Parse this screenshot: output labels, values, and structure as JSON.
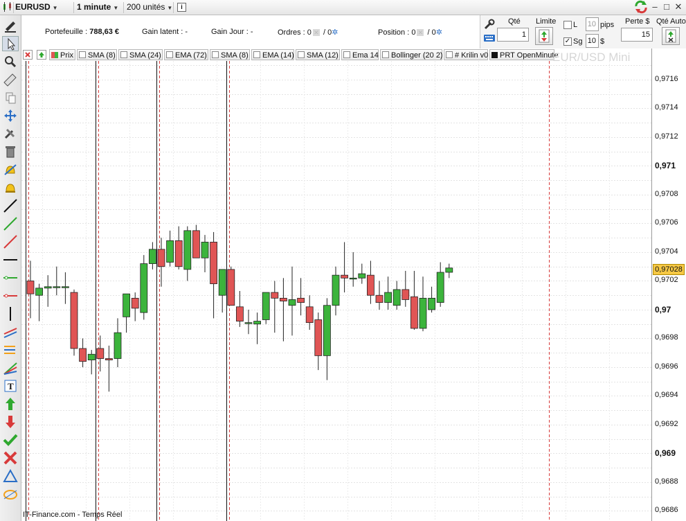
{
  "topbar": {
    "symbol": "EURUSD",
    "timeframe": "1 minute",
    "units": "200 unités",
    "info_icon": "i"
  },
  "account": {
    "portfolio_label": "Portefeuille :",
    "portfolio_value": "788,63 €",
    "latent_label": "Gain latent :",
    "latent_value": "-",
    "day_label": "Gain Jour :",
    "day_value": "-",
    "orders_label": "Ordres :",
    "orders_value_a": "0",
    "orders_sep": "/",
    "orders_value_b": "0",
    "position_label": "Position :",
    "position_value_a": "0",
    "position_sep": "/",
    "position_value_b": "0"
  },
  "order_panel": {
    "qty_label": "Qté",
    "qty_value": "1",
    "limit_label": "Limite",
    "l_label": "L",
    "l_value": "10",
    "l_checked": false,
    "pips_label": "pips",
    "sg_label": "Sg",
    "sg_value": "10",
    "sg_checked": true,
    "sg_unit": "$",
    "loss_label": "Perte $",
    "loss_value": "15",
    "auto_label": "Qté Auto"
  },
  "indicators": [
    {
      "label": "Prix"
    },
    {
      "label": "SMA (8)"
    },
    {
      "label": "SMA (24)"
    },
    {
      "label": "EMA (72)"
    },
    {
      "label": "SMA (8)"
    },
    {
      "label": "EMA (14)"
    },
    {
      "label": "SMA (12)"
    },
    {
      "label": "Ema 14"
    },
    {
      "label": "Bollinger (20 2)"
    },
    {
      "label": "# Krilin v0"
    },
    {
      "label": "PRT OpenMinute"
    }
  ],
  "watermark": "EUR/USD Mini",
  "footer": "IT-Finance.com - Temps Réel",
  "chart_data": {
    "type": "candlestick",
    "symbol": "EUR/USD Mini",
    "ylim": [
      0.96853,
      0.97173
    ],
    "grid": true,
    "y_ticks": [
      "0,9716",
      "0,9714",
      "0,9712",
      "0,971",
      "0,9708",
      "0,9706",
      "0,9704",
      "0,9702",
      "0,97",
      "0,9698",
      "0,9696",
      "0,9694",
      "0,9692",
      "0,969",
      "0,9688",
      "0,9686"
    ],
    "last_price": "0,97028",
    "bullish_color": "#3cb43c",
    "bearish_color": "#e05555",
    "candles": [
      {
        "o": 0.9702,
        "h": 0.97034,
        "l": 0.96994,
        "c": 0.97011
      },
      {
        "o": 0.9701,
        "h": 0.97018,
        "l": 0.96992,
        "c": 0.97015
      },
      {
        "o": 0.97015,
        "h": 0.97024,
        "l": 0.97002,
        "c": 0.97016
      },
      {
        "o": 0.97016,
        "h": 0.9703,
        "l": 0.9701,
        "c": 0.97016
      },
      {
        "o": 0.97016,
        "h": 0.97026,
        "l": 0.97004,
        "c": 0.97016
      },
      {
        "o": 0.97012,
        "h": 0.97014,
        "l": 0.96968,
        "c": 0.96973
      },
      {
        "o": 0.96973,
        "h": 0.9698,
        "l": 0.9696,
        "c": 0.96964
      },
      {
        "o": 0.96965,
        "h": 0.96972,
        "l": 0.96955,
        "c": 0.96969
      },
      {
        "o": 0.96973,
        "h": 0.96982,
        "l": 0.96957,
        "c": 0.96966
      },
      {
        "o": 0.96966,
        "h": 0.96975,
        "l": 0.96943,
        "c": 0.96965
      },
      {
        "o": 0.96966,
        "h": 0.96994,
        "l": 0.9696,
        "c": 0.96984
      },
      {
        "o": 0.96995,
        "h": 0.9701,
        "l": 0.96984,
        "c": 0.97011
      },
      {
        "o": 0.97008,
        "h": 0.97012,
        "l": 0.96992,
        "c": 0.97001
      },
      {
        "o": 0.96998,
        "h": 0.97038,
        "l": 0.96993,
        "c": 0.97032
      },
      {
        "o": 0.97032,
        "h": 0.97047,
        "l": 0.97028,
        "c": 0.97042
      },
      {
        "o": 0.97042,
        "h": 0.9705,
        "l": 0.97016,
        "c": 0.9703
      },
      {
        "o": 0.97033,
        "h": 0.97055,
        "l": 0.9703,
        "c": 0.97048
      },
      {
        "o": 0.97048,
        "h": 0.97058,
        "l": 0.97028,
        "c": 0.9703
      },
      {
        "o": 0.97028,
        "h": 0.97058,
        "l": 0.9702,
        "c": 0.97055
      },
      {
        "o": 0.97055,
        "h": 0.97059,
        "l": 0.97036,
        "c": 0.97036
      },
      {
        "o": 0.97036,
        "h": 0.97052,
        "l": 0.97026,
        "c": 0.97047
      },
      {
        "o": 0.97047,
        "h": 0.97054,
        "l": 0.96994,
        "c": 0.97018
      },
      {
        "o": 0.9701,
        "h": 0.97025,
        "l": 0.96998,
        "c": 0.97028
      },
      {
        "o": 0.97028,
        "h": 0.9703,
        "l": 0.97003,
        "c": 0.97003
      },
      {
        "o": 0.97002,
        "h": 0.97013,
        "l": 0.96988,
        "c": 0.96992
      },
      {
        "o": 0.96991,
        "h": 0.97,
        "l": 0.96983,
        "c": 0.96991
      },
      {
        "o": 0.9699,
        "h": 0.96998,
        "l": 0.96976,
        "c": 0.96992
      },
      {
        "o": 0.96993,
        "h": 0.97012,
        "l": 0.9699,
        "c": 0.97012
      },
      {
        "o": 0.97012,
        "h": 0.9702,
        "l": 0.96984,
        "c": 0.97008
      },
      {
        "o": 0.97008,
        "h": 0.97022,
        "l": 0.96978,
        "c": 0.97006
      },
      {
        "o": 0.97003,
        "h": 0.9703,
        "l": 0.96982,
        "c": 0.97007
      },
      {
        "o": 0.97008,
        "h": 0.97022,
        "l": 0.96996,
        "c": 0.97005
      },
      {
        "o": 0.97002,
        "h": 0.9701,
        "l": 0.96986,
        "c": 0.96991
      },
      {
        "o": 0.96993,
        "h": 0.96998,
        "l": 0.96958,
        "c": 0.96968
      },
      {
        "o": 0.96968,
        "h": 0.97008,
        "l": 0.96951,
        "c": 0.97003
      },
      {
        "o": 0.97003,
        "h": 0.9703,
        "l": 0.96996,
        "c": 0.97024
      },
      {
        "o": 0.97024,
        "h": 0.97047,
        "l": 0.97012,
        "c": 0.97022
      },
      {
        "o": 0.97022,
        "h": 0.9704,
        "l": 0.97016,
        "c": 0.97022
      },
      {
        "o": 0.97022,
        "h": 0.97032,
        "l": 0.97018,
        "c": 0.97025
      },
      {
        "o": 0.97024,
        "h": 0.97034,
        "l": 0.97004,
        "c": 0.9701
      },
      {
        "o": 0.9701,
        "h": 0.9702,
        "l": 0.97,
        "c": 0.97005
      },
      {
        "o": 0.97005,
        "h": 0.97023,
        "l": 0.97,
        "c": 0.97012
      },
      {
        "o": 0.97003,
        "h": 0.9702,
        "l": 0.97,
        "c": 0.97014
      },
      {
        "o": 0.97014,
        "h": 0.97027,
        "l": 0.97002,
        "c": 0.97007
      },
      {
        "o": 0.97009,
        "h": 0.97027,
        "l": 0.96986,
        "c": 0.96987
      },
      {
        "o": 0.96987,
        "h": 0.97023,
        "l": 0.96985,
        "c": 0.97008
      },
      {
        "o": 0.97,
        "h": 0.97016,
        "l": 0.96998,
        "c": 0.97008
      },
      {
        "o": 0.97005,
        "h": 0.97033,
        "l": 0.97002,
        "c": 0.97026
      },
      {
        "o": 0.97026,
        "h": 0.97032,
        "l": 0.97022,
        "c": 0.97029
      }
    ],
    "session_markers": [
      0,
      8,
      15,
      23
    ]
  }
}
